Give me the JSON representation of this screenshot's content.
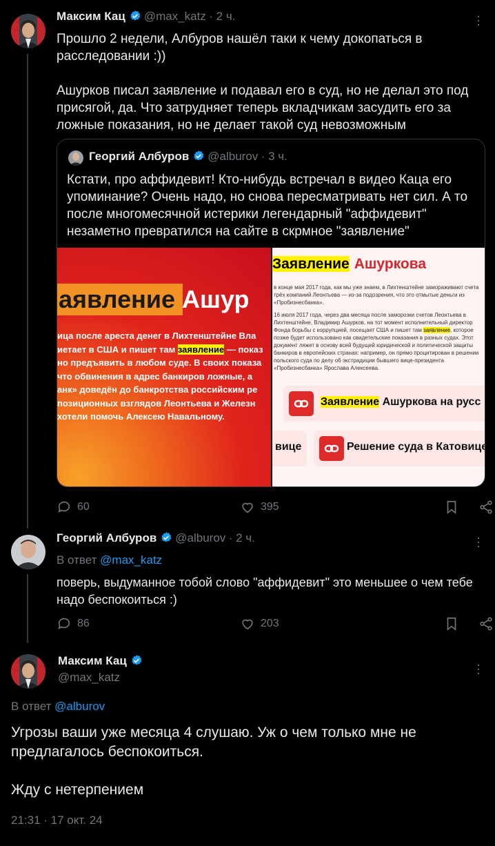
{
  "tweet1": {
    "name": "Максим Кац",
    "handle": "@max_katz",
    "time": "· 2 ч.",
    "text_line1": "Прошло 2 недели, Албуров нашёл таки к чему докопаться в",
    "text_line2": "расследовании :))",
    "text_line3": "Ашурков писал заявление и подавал его в суд, но не делал это под",
    "text_line4": "присягой, да. Что затрудняет теперь вкладчикам засудить его за",
    "text_line5": "ложные показания, но не делает такой суд невозможным",
    "replies": "60",
    "likes": "395"
  },
  "quote": {
    "name": "Георгий Албуров",
    "handle": "@alburov",
    "time": "· 3 ч.",
    "text_line1": "Кстати, про аффидевит! Кто-нибудь встречал в видео Каца его",
    "text_line2": "упоминание? Очень надо, но снова пересматривать нет сил. А то",
    "text_line3": "после многомесячной истерики легендарный \"аффидевит\"",
    "text_line4": "незаметно превратился на сайте в скрмное \"заявление\"",
    "left_img": {
      "title_a": "аявление",
      "title_b": "Ашур",
      "line1": "ица после ареста денег в Лихтенштейне Вла",
      "line2a": "иетает в США и пишет там ",
      "line2hl": "заявление",
      "line2b": " — показ",
      "line3": "но предъявить в любом суде. В своих показа",
      "line4": "что обвинения в адрес банкиров ложные, а",
      "line5": "анк» доведён до банкротства российским ре",
      "line6": "позиционных взглядов Леонтьева и Железн",
      "line7": "хотели помочь Алексею Навальному."
    },
    "right_img": {
      "title_hl": "Заявление",
      "title_b": "Ашуркова",
      "p1": "в конце мая 2017 года, как мы уже знаем, в Лихтенштейне замораживают счета трёх компаний Леонтьева — из-за подозрения, что это отмытые деньги из «Пробизнесбанка».",
      "p2a": "16 июля 2017 года, через два месяца после заморозки счетов Леонтьева в Лихтенштейне, Владимир Ашурков, на тот момент исполнительный директор Фонда борьбы с коррупцией, посещает США и пишет там ",
      "p2hl": "заявление",
      "p2b": ", которое позже будет использовано как свидетельские показания в разных судах. Этот документ ляжет в основу всей будущей юридической и политической защиты банкиров в европейских странах: например, он прямо процитирован в решении польского суда по делу об экстрадиции бывшего вице-президента «Пробизнесбанка» Ярослава Алексеева.",
      "link1_hl": "Заявление",
      "link1_b": " Ашуркова на русс",
      "link2_a": "вице",
      "link2_b": "Решение суда в Катовице"
    }
  },
  "tweet2": {
    "name": "Георгий Албуров",
    "handle": "@alburov",
    "time": "· 2 ч.",
    "reply_prefix": "В ответ ",
    "reply_mention": "@max_katz",
    "text_line1": "поверь, выдуманное тобой слово \"аффидевит\" это меньшее о чем тебе",
    "text_line2": "надо беспокоиться :)",
    "replies": "86",
    "likes": "203"
  },
  "tweet3": {
    "name": "Максим Кац",
    "handle": "@max_katz",
    "reply_prefix": "В ответ ",
    "reply_mention": "@alburov",
    "text_line1": "Угрозы ваши уже месяца 4 слушаю. Уж о чем только мне не",
    "text_line2": "предлагалось беспокоиться.",
    "text_line3": "Жду с нетерпением",
    "timestamp": "21:31 · 17 окт. 24"
  },
  "colors": {
    "background": "#000000",
    "text": "#e7e9ea",
    "muted": "#71767b",
    "link": "#1d9bf0",
    "verified": "#1d9bf0",
    "border": "#333639"
  },
  "icons": [
    "verified-icon",
    "more-icon",
    "reply-icon",
    "like-icon",
    "bookmark-icon",
    "share-icon",
    "link-icon"
  ]
}
